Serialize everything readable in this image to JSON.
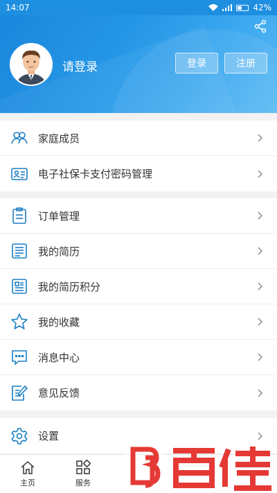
{
  "status": {
    "time": "14:07",
    "battery": "42%"
  },
  "header": {
    "login_hint": "请登录",
    "login_label": "登录",
    "register_label": "注册"
  },
  "groups": [
    {
      "items": [
        {
          "label": "家庭成员",
          "icon": "family-icon"
        },
        {
          "label": "电子社保卡支付密码管理",
          "icon": "id-card-icon"
        }
      ]
    },
    {
      "items": [
        {
          "label": "订单管理",
          "icon": "clipboard-icon"
        },
        {
          "label": "我的简历",
          "icon": "document-icon"
        },
        {
          "label": "我的简历积分",
          "icon": "document-points-icon"
        },
        {
          "label": "我的收藏",
          "icon": "star-icon"
        },
        {
          "label": "消息中心",
          "icon": "message-icon"
        },
        {
          "label": "意见反馈",
          "icon": "feedback-icon"
        }
      ]
    },
    {
      "items": [
        {
          "label": "设置",
          "icon": "gear-icon"
        }
      ]
    }
  ],
  "tabs": [
    {
      "label": "主页",
      "icon": "home-icon"
    },
    {
      "label": "服务",
      "icon": "grid-icon"
    },
    {
      "label": "",
      "icon": "scan-icon"
    },
    {
      "label": "",
      "icon": "tab-icon"
    },
    {
      "label": "",
      "icon": "mine-icon"
    }
  ],
  "colors": {
    "brand": "#1e8fe0",
    "icon": "#1a7fc4",
    "watermark": "#e53935"
  }
}
